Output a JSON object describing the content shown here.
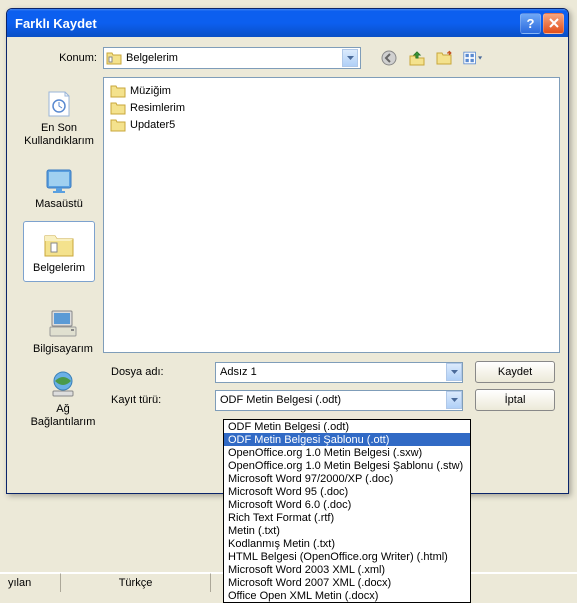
{
  "title": "Farklı Kaydet",
  "konum_label": "Konum:",
  "konum_value": "Belgelerim",
  "sidebar": {
    "recent": "En Son Kullandıklarım",
    "desktop": "Masaüstü",
    "mydocs": "Belgelerim",
    "mycomputer": "Bilgisayarım",
    "network": "Ağ Bağlantılarım"
  },
  "files": [
    "Müziğim",
    "Resimlerim",
    "Updater5"
  ],
  "filename_label": "Dosya adı:",
  "filename_value": "Adsız 1",
  "filetype_label": "Kayıt türü:",
  "filetype_value": "ODF Metin Belgesi (.odt)",
  "save_btn": "Kaydet",
  "cancel_btn": "İptal",
  "dropdown": [
    "ODF Metin Belgesi (.odt)",
    "ODF Metin Belgesi Şablonu (.ott)",
    "OpenOffice.org 1.0 Metin Belgesi (.sxw)",
    "OpenOffice.org 1.0 Metin Belgesi Şablonu (.stw)",
    "Microsoft Word 97/2000/XP (.doc)",
    "Microsoft Word 95 (.doc)",
    "Microsoft Word 6.0 (.doc)",
    "Rich Text Format (.rtf)",
    "Metin (.txt)",
    "Kodlanmış Metin (.txt)",
    "HTML Belgesi (OpenOffice.org Writer) (.html)",
    "Microsoft Word 2003 XML (.xml)",
    "Microsoft Word 2007 XML (.docx)",
    "Office Open XML Metin (.docx)"
  ],
  "selected_index": 1,
  "statusbar": {
    "cell1": "yılan",
    "cell2": "Türkçe"
  }
}
